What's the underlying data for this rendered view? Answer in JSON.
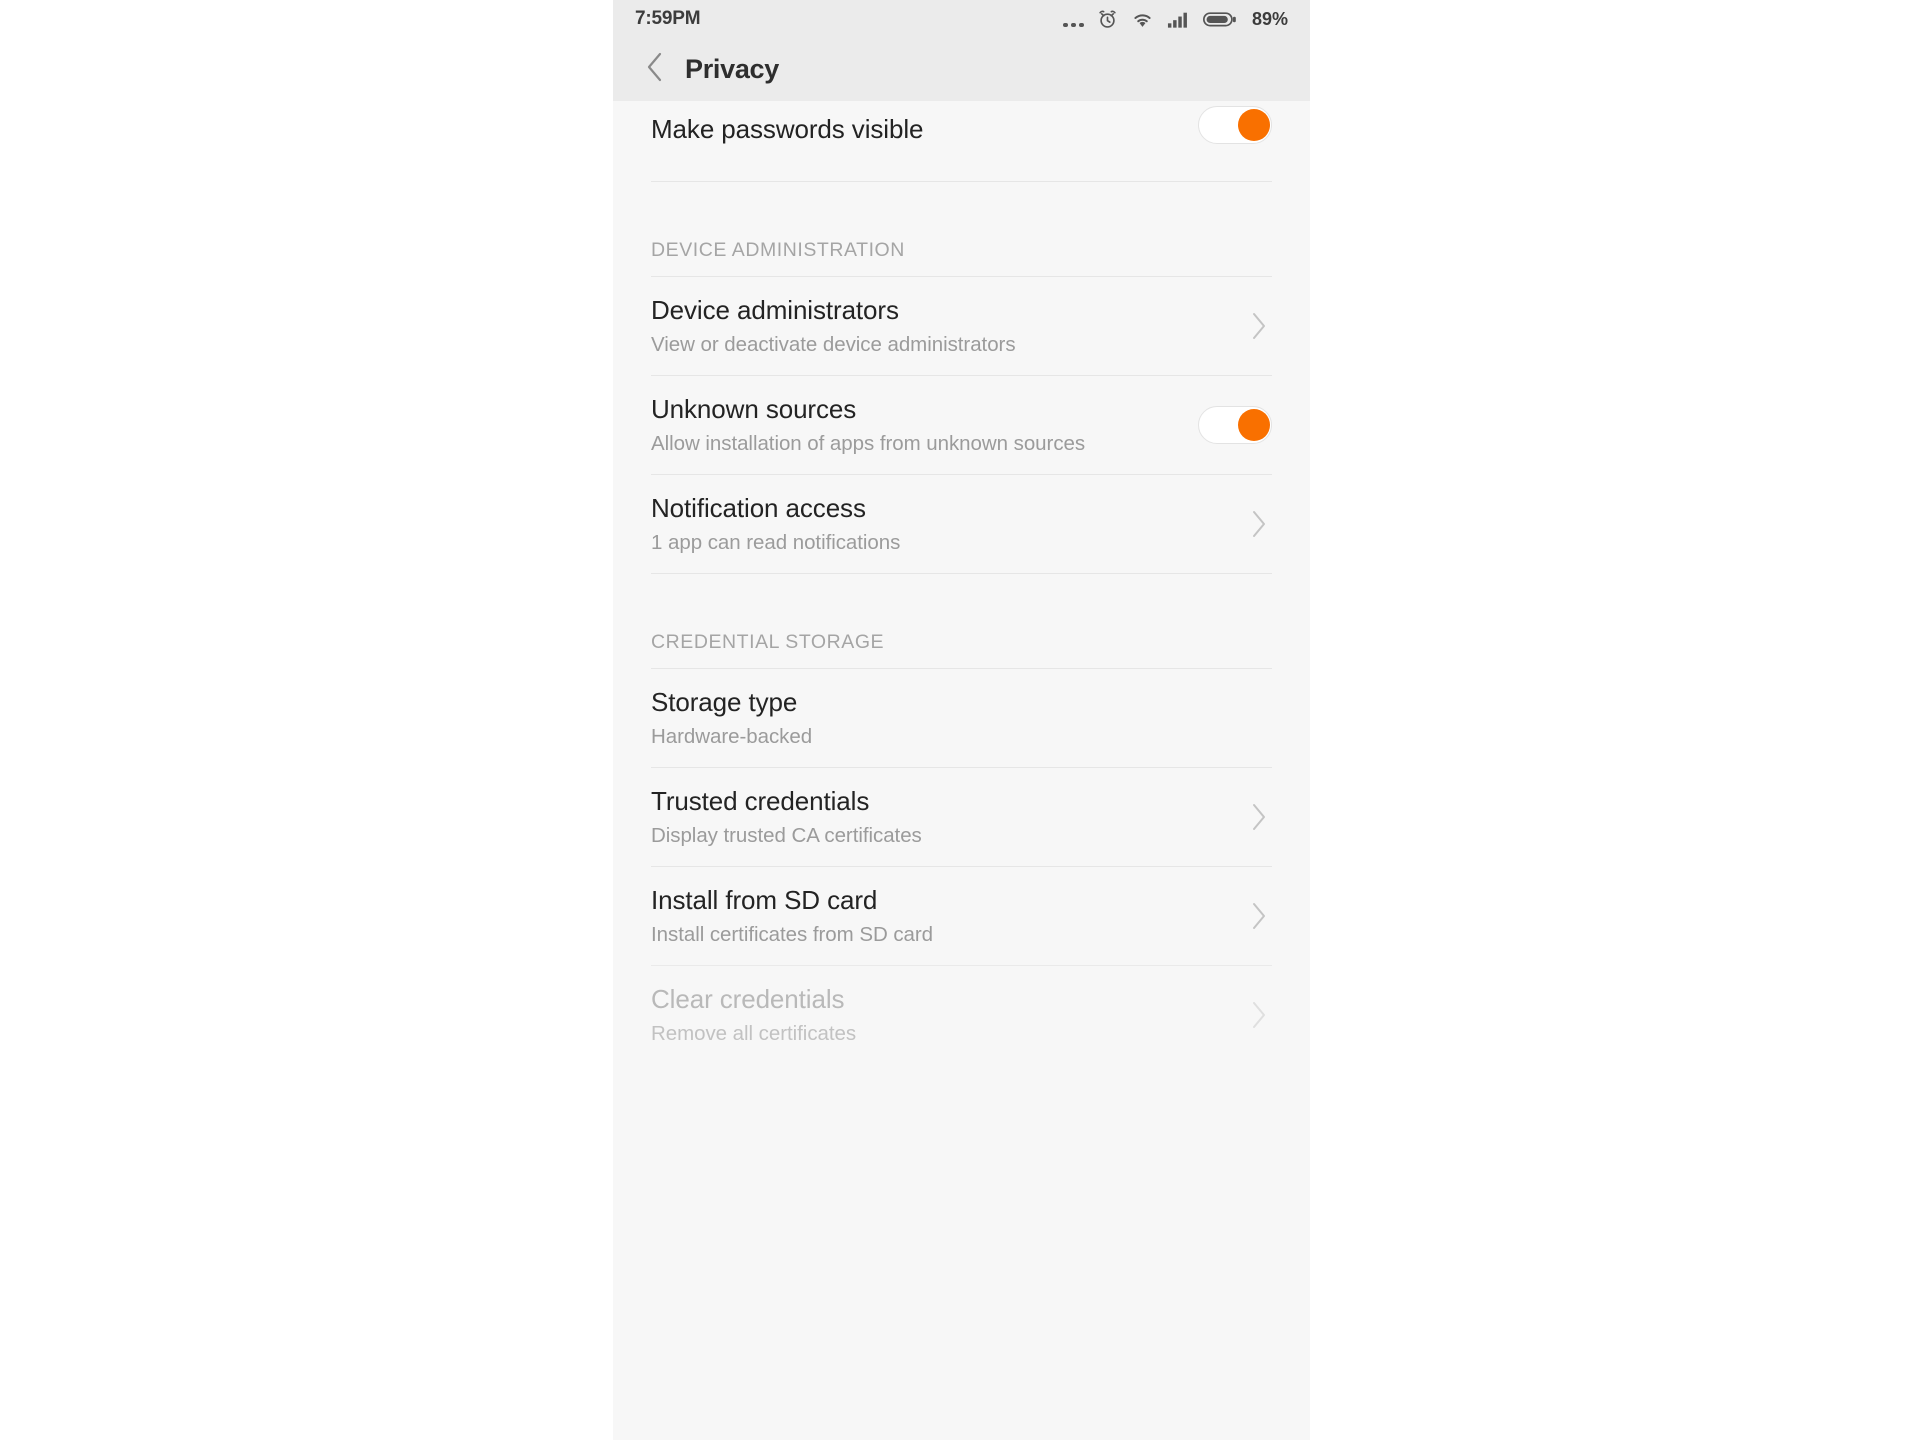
{
  "statusbar": {
    "time": "7:59PM",
    "battery_percent": "89%",
    "icons": [
      "more-dots-icon",
      "alarm-clock-icon",
      "wifi-icon",
      "cellular-signal-icon",
      "battery-icon"
    ]
  },
  "header": {
    "title": "Privacy",
    "back_icon": "chevron-left-icon"
  },
  "colors": {
    "accent_orange": "#f97000",
    "background": "#f7f7f7",
    "bar_background": "#ebebeb",
    "title_text": "#232323",
    "subtitle_text": "#9b9b9b",
    "disabled_text": "#b9b9b9",
    "divider": "#e6e6e6"
  },
  "list": [
    {
      "name": "make-passwords-visible",
      "title": "Make passwords visible",
      "subtitle": "",
      "control": "toggle",
      "toggle_state": "on",
      "clipped": true,
      "enabled": true
    },
    {
      "name": "device-administration",
      "type": "section",
      "title": "DEVICE ADMINISTRATION"
    },
    {
      "name": "device-administrators",
      "title": "Device administrators",
      "subtitle": "View or deactivate device administrators",
      "control": "chevron",
      "enabled": true
    },
    {
      "name": "unknown-sources",
      "title": "Unknown sources",
      "subtitle": "Allow installation of apps from unknown sources",
      "control": "toggle",
      "toggle_state": "on",
      "enabled": true
    },
    {
      "name": "notification-access",
      "title": "Notification access",
      "subtitle": "1 app can read notifications",
      "control": "chevron",
      "enabled": true
    },
    {
      "name": "credential-storage",
      "type": "section",
      "title": "CREDENTIAL STORAGE"
    },
    {
      "name": "storage-type",
      "title": "Storage type",
      "subtitle": "Hardware-backed",
      "control": "none",
      "enabled": true
    },
    {
      "name": "trusted-credentials",
      "title": "Trusted credentials",
      "subtitle": "Display trusted CA certificates",
      "control": "chevron",
      "enabled": true
    },
    {
      "name": "install-from-sd-card",
      "title": "Install from SD card",
      "subtitle": "Install certificates from SD card",
      "control": "chevron",
      "enabled": true
    },
    {
      "name": "clear-credentials",
      "title": "Clear credentials",
      "subtitle": "Remove all certificates",
      "control": "chevron",
      "enabled": false
    }
  ]
}
